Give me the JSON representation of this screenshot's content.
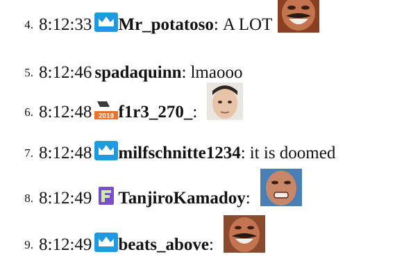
{
  "chat": {
    "messages": [
      {
        "index": "4.",
        "time": "8:12:33",
        "badge_icon": "crown-badge-icon",
        "username": "Mr_potatoso",
        "separator": ":",
        "text": "A LOT",
        "emote_icon": "mustache-laughing-face-emote"
      },
      {
        "index": "5.",
        "time": "8:12:46",
        "badge_icon": "",
        "username": "spadaquinn",
        "separator": ":",
        "text": "lmaooo",
        "emote_icon": ""
      },
      {
        "index": "6.",
        "time": "8:12:48",
        "badge_icon": "2019-event-badge-icon",
        "badge_text": "2019",
        "username": "f1r3_270_",
        "separator": ":",
        "text": "",
        "emote_icon": "face-emote"
      },
      {
        "index": "7.",
        "time": "8:12:48",
        "badge_icon": "crown-badge-icon",
        "username": "milfschnitte1234",
        "separator": ":",
        "text": "it is doomed",
        "emote_icon": ""
      },
      {
        "index": "8.",
        "time": "8:12:49",
        "badge_icon": "purple-gem-badge-icon",
        "username": "TanjiroKamadoy",
        "separator": ":",
        "text": "",
        "emote_icon": "grimacing-face-emote"
      },
      {
        "index": "9.",
        "time": "8:12:49",
        "badge_icon": "crown-badge-icon",
        "username": "beats_above",
        "separator": ":",
        "text": "",
        "emote_icon": "mustache-laughing-face-emote"
      }
    ]
  },
  "colors": {
    "crown_badge": "#1e9be0",
    "gem_badge": "#7b4fc9",
    "event_badge": "#e8732a",
    "skin": "#c98e6b",
    "emote_bg": "#b55d3a"
  }
}
